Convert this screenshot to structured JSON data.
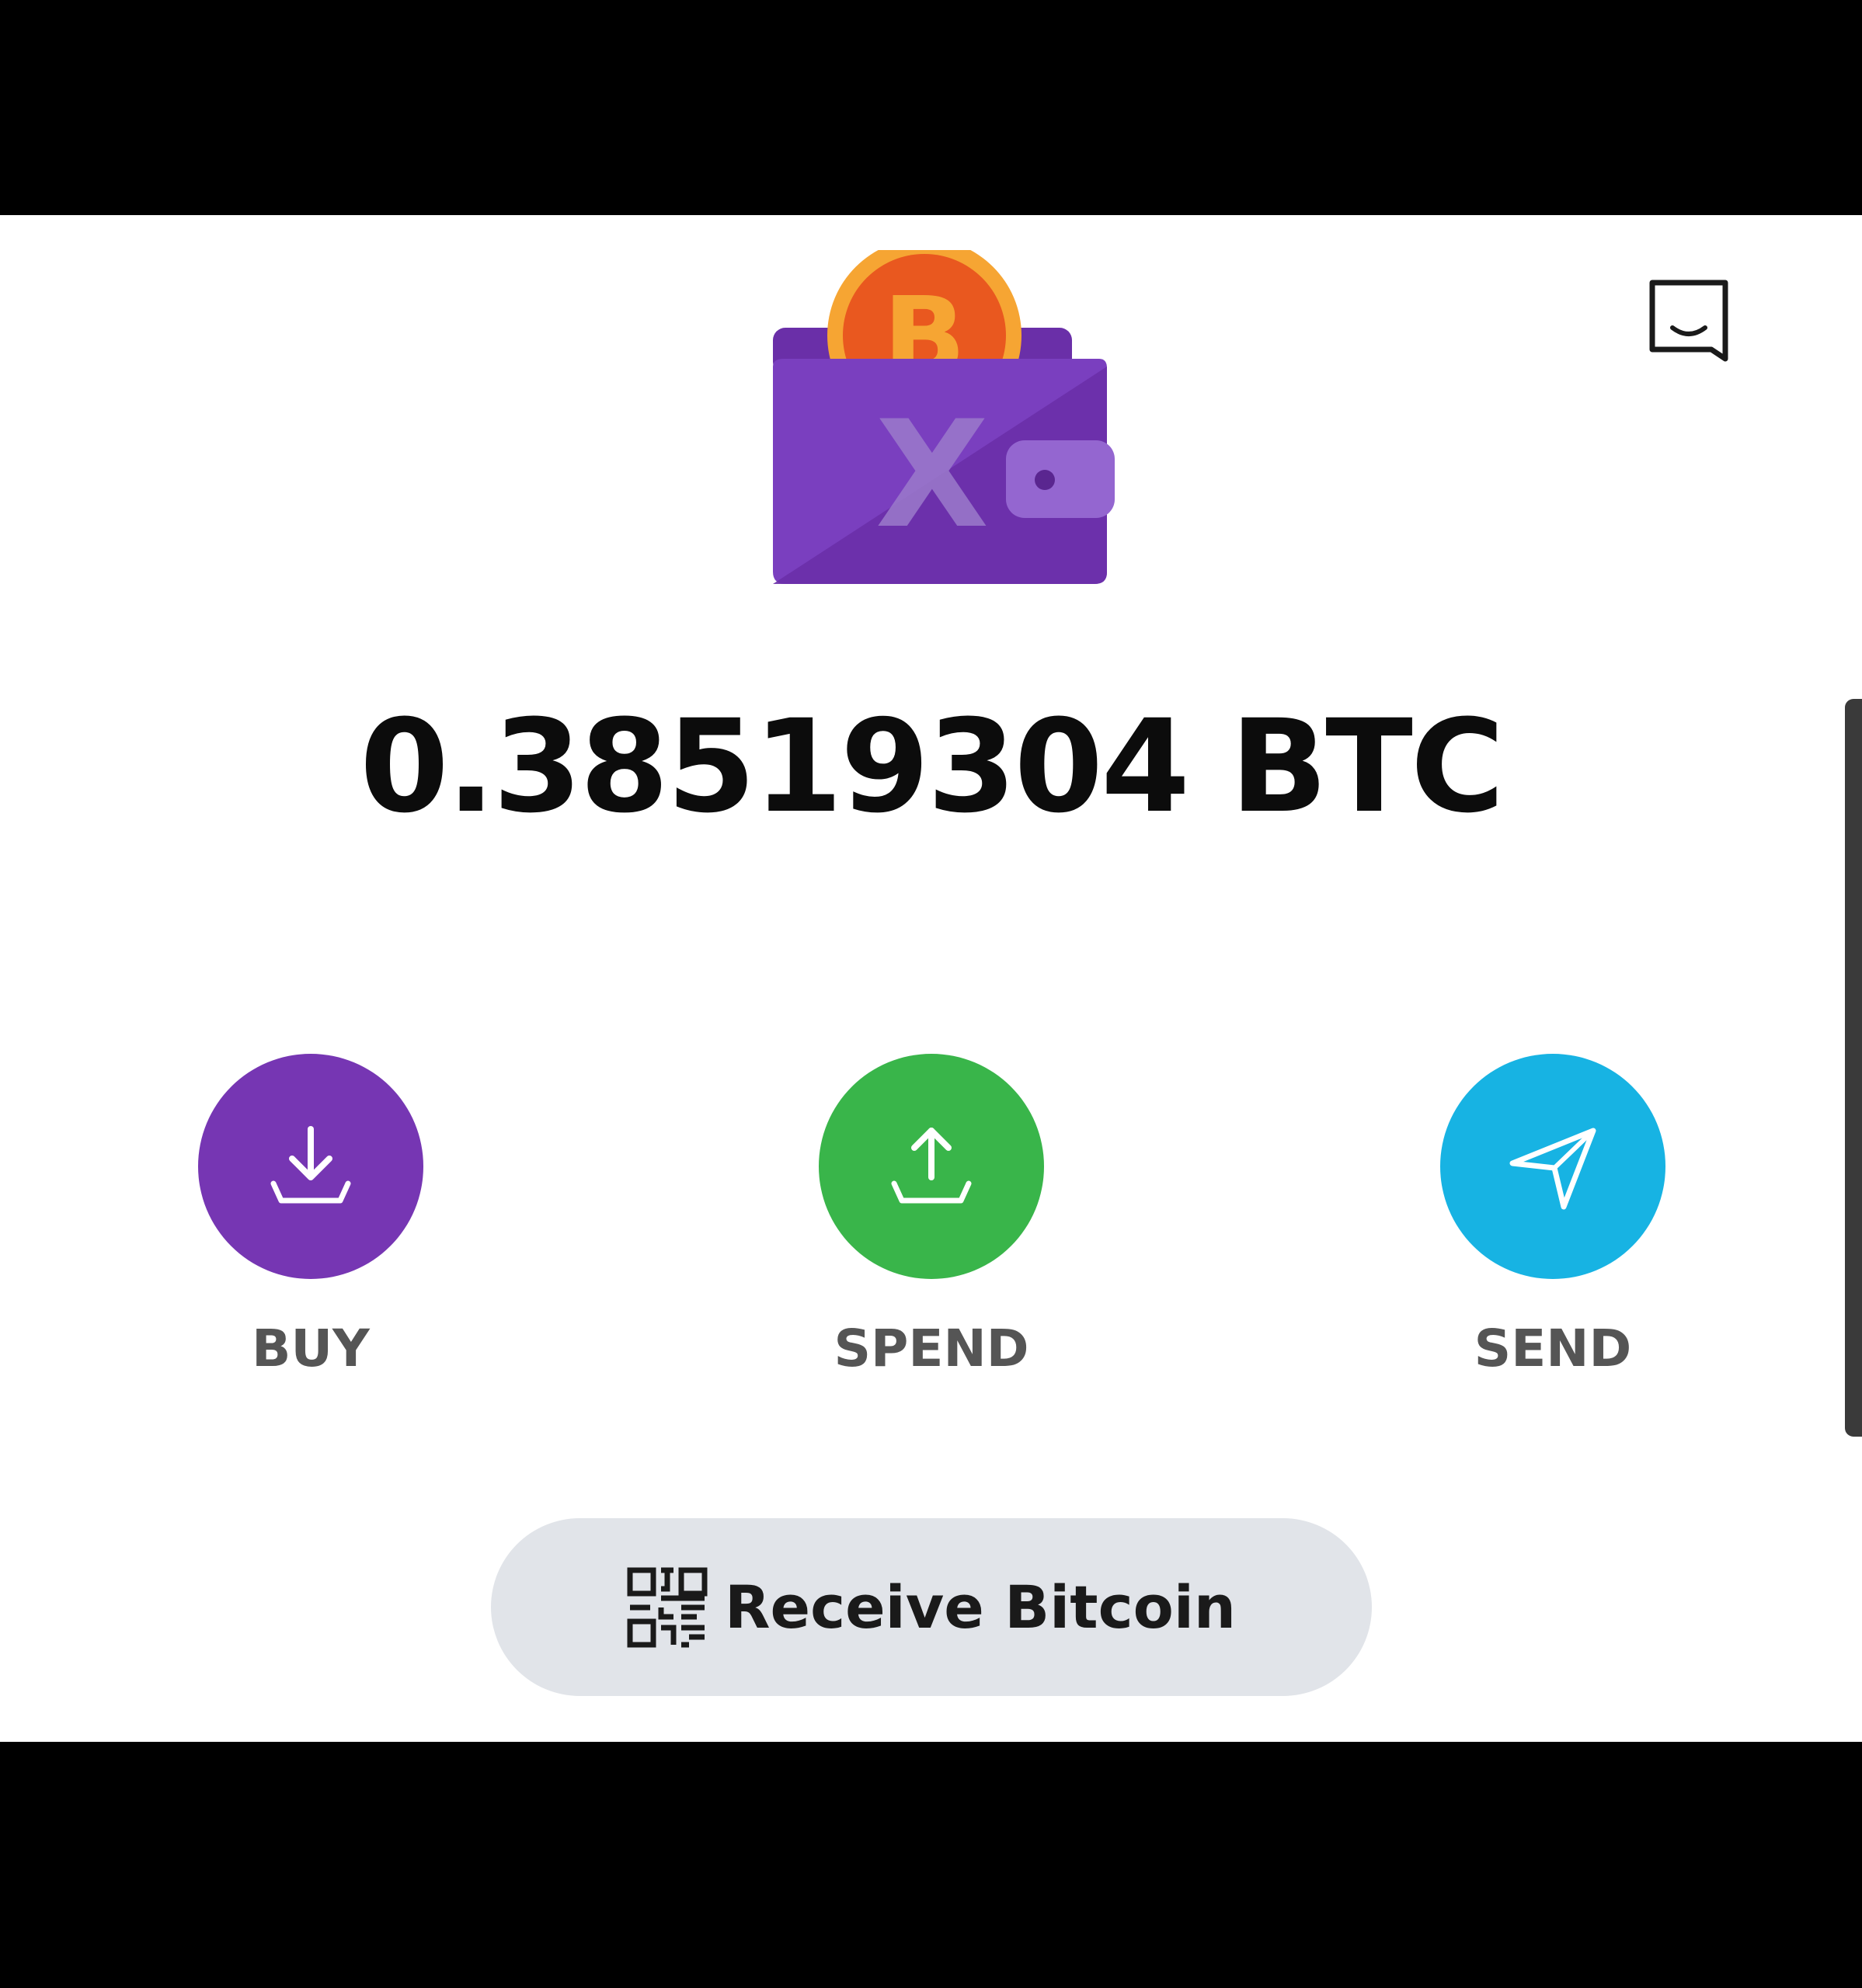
{
  "header": {
    "chat_icon": "chat-bubble-icon"
  },
  "wallet": {
    "logo_icon": "bitcoin-wallet-logo",
    "logo_letter": "X",
    "balance": "0.38519304 BTC"
  },
  "actions": [
    {
      "label": "BUY",
      "icon": "download-tray-icon",
      "color": "#7636b3"
    },
    {
      "label": "SPEND",
      "icon": "upload-tray-icon",
      "color": "#39b54a"
    },
    {
      "label": "SEND",
      "icon": "paper-plane-icon",
      "color": "#17b3e3"
    }
  ],
  "receive": {
    "label": "Receive Bitcoin",
    "icon": "qr-code-icon"
  },
  "colors": {
    "wallet_purple": "#7a3fbf",
    "bitcoin_orange": "#f08a24",
    "receive_bg": "#e1e4e9"
  }
}
